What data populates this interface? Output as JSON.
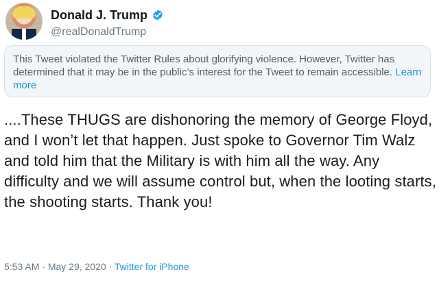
{
  "user": {
    "display_name": "Donald J. Trump",
    "handle": "@realDonaldTrump",
    "avatar_icon": "profile-photo",
    "verified_icon": "verified-badge-icon"
  },
  "notice": {
    "text": "This Tweet violated the Twitter Rules about glorifying violence. However, Twitter has determined that it may be in the public’s interest for the Tweet to remain accessible.",
    "link": "Learn more"
  },
  "tweet": {
    "text": "....These THUGS are dishonoring the memory of George Floyd, and I won’t let that happen. Just spoke to Governor Tim Walz and told him that the Military is with him all the way. Any difficulty and we will assume control but, when the looting starts, the shooting starts. Thank you!"
  },
  "meta": {
    "time": "5:53 AM",
    "separator": " · ",
    "date": "May 29, 2020",
    "source": "Twitter for iPhone"
  },
  "colors": {
    "link": "#1b95e0",
    "verified": "#1da1f2",
    "notice_background": "#f3f6f8"
  }
}
